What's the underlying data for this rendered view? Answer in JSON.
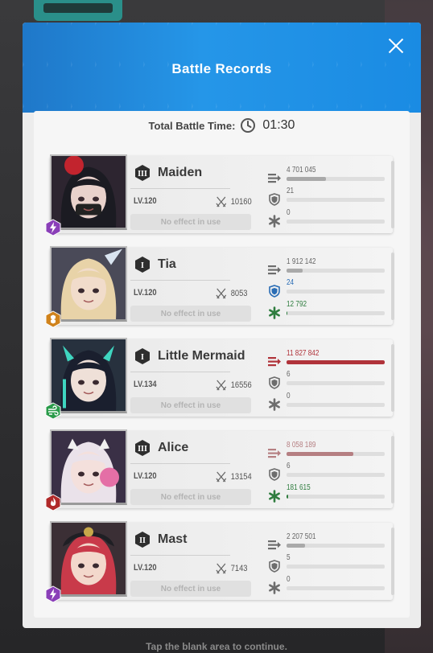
{
  "modal": {
    "title": "Battle Records",
    "total_battle_time_label": "Total Battle Time:",
    "total_battle_time_value": "01:30"
  },
  "effect_placeholder": "No effect in use",
  "footer_hint": "Tap the blank area to continue.",
  "colors": {
    "header_blue": "#1f78c9",
    "damage_red": "#b0333a",
    "damage_pink": "#b57f82",
    "grey_bar": "#a9a9a9",
    "shield_blue": "#2a6db5",
    "heal_green": "#2f7d3f"
  },
  "units": [
    {
      "name": "Maiden",
      "burst": "III",
      "class_icon": "lightning-icon",
      "class_color": "#8a3fb8",
      "level": "LV.120",
      "power": "10160",
      "damage": {
        "text": "4 701 045",
        "fraction": 0.4,
        "color": "#a9a9a9"
      },
      "shield": {
        "text": "21",
        "fraction": 0,
        "color": "#a9a9a9"
      },
      "heal": {
        "text": "0",
        "fraction": 0,
        "color": "#a9a9a9"
      }
    },
    {
      "name": "Tia",
      "burst": "I",
      "class_icon": "honeycomb-icon",
      "class_color": "#d0831c",
      "level": "LV.120",
      "power": "8053",
      "damage": {
        "text": "1 912 142",
        "fraction": 0.16,
        "color": "#a9a9a9"
      },
      "shield": {
        "text": "24",
        "fraction": 0,
        "color": "#2a6db5"
      },
      "heal": {
        "text": "12 792",
        "fraction": 0.01,
        "color": "#2f7d3f"
      }
    },
    {
      "name": "Little Mermaid",
      "burst": "I",
      "class_icon": "wind-icon",
      "class_color": "#2a9b4a",
      "level": "LV.134",
      "power": "16556",
      "damage": {
        "text": "11 827 842",
        "fraction": 1.0,
        "color": "#b0333a"
      },
      "shield": {
        "text": "6",
        "fraction": 0,
        "color": "#a9a9a9"
      },
      "heal": {
        "text": "0",
        "fraction": 0,
        "color": "#a9a9a9"
      }
    },
    {
      "name": "Alice",
      "burst": "III",
      "class_icon": "fire-icon",
      "class_color": "#b02a2a",
      "level": "LV.120",
      "power": "13154",
      "damage": {
        "text": "8 058 189",
        "fraction": 0.68,
        "color": "#b57f82"
      },
      "shield": {
        "text": "6",
        "fraction": 0,
        "color": "#a9a9a9"
      },
      "heal": {
        "text": "181 615",
        "fraction": 0.02,
        "color": "#2f7d3f"
      }
    },
    {
      "name": "Mast",
      "burst": "II",
      "class_icon": "lightning-icon",
      "class_color": "#8a3fb8",
      "level": "LV.120",
      "power": "7143",
      "damage": {
        "text": "2 207 501",
        "fraction": 0.19,
        "color": "#a9a9a9"
      },
      "shield": {
        "text": "5",
        "fraction": 0,
        "color": "#a9a9a9"
      },
      "heal": {
        "text": "0",
        "fraction": 0,
        "color": "#a9a9a9"
      }
    }
  ]
}
